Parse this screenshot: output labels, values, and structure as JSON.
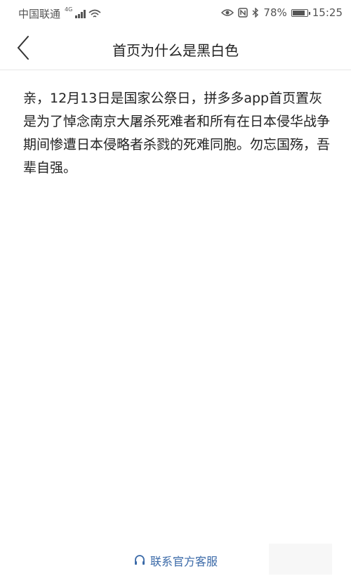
{
  "status_bar": {
    "carrier": "中国联通",
    "network": "4G",
    "battery": "78%",
    "battery_level": 0.78,
    "time": "15:25"
  },
  "nav": {
    "title": "首页为什么是黑白色"
  },
  "content": {
    "body": "亲，12月13日是国家公祭日，拼多多app首页置灰是为了悼念南京大屠杀死难者和所有在日本侵华战争期间惨遭日本侵略者杀戮的死难同胞。勿忘国殇，吾辈自强。"
  },
  "footer": {
    "contact_label": "联系官方客服"
  },
  "colors": {
    "link": "#3b6aa8",
    "text": "#222222"
  }
}
